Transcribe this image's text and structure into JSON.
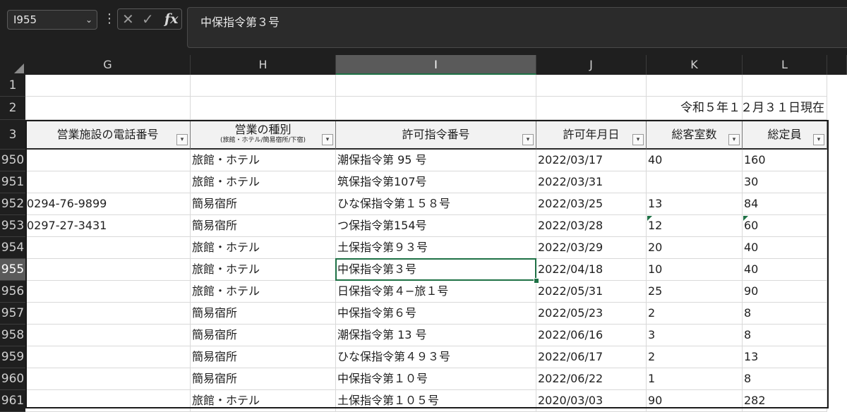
{
  "name_box": {
    "value": "I955",
    "dropdown_icon": "chevron-down-icon"
  },
  "formula": {
    "value": "中保指令第３号",
    "cancel_icon": "close-icon",
    "enter_icon": "check-icon",
    "fx_label": "fx"
  },
  "columns": [
    "G",
    "H",
    "I",
    "J",
    "K",
    "L"
  ],
  "active_column": "I",
  "row1": "1",
  "row2": {
    "num": "2",
    "date_note": "令和５年１２月３１日現在"
  },
  "header_row": {
    "num": "3",
    "labels": [
      "営業施設の電話番号",
      "営業の種別",
      "許可指令番号",
      "許可年月日",
      "総客室数",
      "総定員"
    ],
    "h_sub": "(旅館・ホテル/簡易宿所/下宿)"
  },
  "rows": [
    {
      "num": "950",
      "cells": [
        "",
        "旅館・ホテル",
        "潮保指令第 95 号",
        "2022/03/17",
        "40",
        "160"
      ]
    },
    {
      "num": "951",
      "cells": [
        "",
        "旅館・ホテル",
        "筑保指令第107号",
        "2022/03/31",
        "",
        "30"
      ]
    },
    {
      "num": "952",
      "cells": [
        "0294-76-9899",
        "簡易宿所",
        "ひな保指令第１５８号",
        "2022/03/25",
        "13",
        "84"
      ]
    },
    {
      "num": "953",
      "cells": [
        "0297-27-3431",
        "簡易宿所",
        "つ保指令第154号",
        "2022/03/28",
        "12",
        "60"
      ]
    },
    {
      "num": "954",
      "cells": [
        "",
        "旅館・ホテル",
        "土保指令第９３号",
        "2022/03/29",
        "20",
        "40"
      ]
    },
    {
      "num": "955",
      "cells": [
        "",
        "旅館・ホテル",
        "中保指令第３号",
        "2022/04/18",
        "10",
        "40"
      ]
    },
    {
      "num": "956",
      "cells": [
        "",
        "旅館・ホテル",
        "日保指令第４−旅１号",
        "2022/05/31",
        "25",
        "90"
      ]
    },
    {
      "num": "957",
      "cells": [
        "",
        "簡易宿所",
        "中保指令第６号",
        "2022/05/23",
        "2",
        "8"
      ]
    },
    {
      "num": "958",
      "cells": [
        "",
        "簡易宿所",
        "潮保指令第 13 号",
        "2022/06/16",
        "3",
        "8"
      ]
    },
    {
      "num": "959",
      "cells": [
        "",
        "簡易宿所",
        "ひな保指令第４９３号",
        "2022/06/17",
        "2",
        "13"
      ]
    },
    {
      "num": "960",
      "cells": [
        "",
        "簡易宿所",
        "中保指令第１０号",
        "2022/06/22",
        "1",
        "8"
      ]
    },
    {
      "num": "961",
      "cells": [
        "",
        "旅館・ホテル",
        "土保指令第１０５号",
        "2020/03/03",
        "90",
        "282"
      ]
    }
  ],
  "active_row": "955",
  "colors": {
    "selection": "#1e7145",
    "ribbon_bg": "#1f1f1f"
  }
}
